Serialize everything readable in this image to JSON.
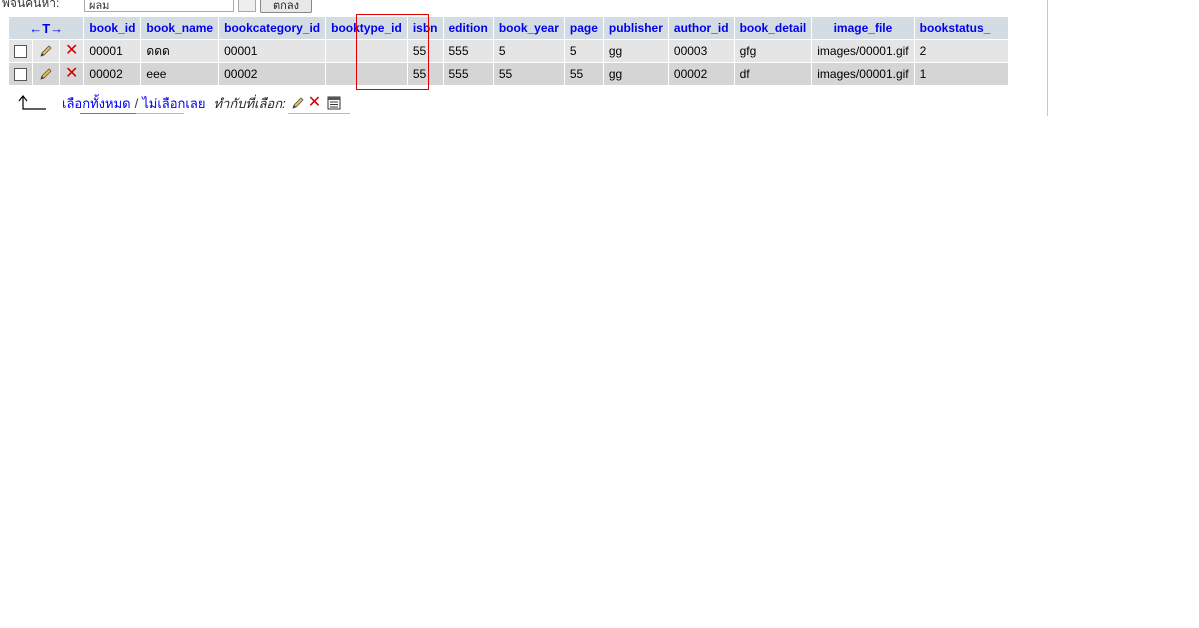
{
  "search": {
    "label": "พจน์ค้นหา:",
    "value": "ผลม",
    "go_label": "ตกลง"
  },
  "table": {
    "arrows_header": "←T→",
    "columns": [
      "book_id",
      "book_name",
      "bookcategory_id",
      "booktype_id",
      "isbn",
      "edition",
      "book_year",
      "page",
      "publisher",
      "author_id",
      "book_detail",
      "image_file",
      "bookstatus_"
    ],
    "rows": [
      {
        "book_id": "00001",
        "book_name": "ดดด",
        "bookcategory_id": "00001",
        "booktype_id": "",
        "isbn": "55",
        "edition": "555",
        "book_year": "5",
        "page": "5",
        "publisher": "gg",
        "author_id": "00003",
        "book_detail": "gfg",
        "image_file": "images/00001.gif",
        "bookstatus_": "2"
      },
      {
        "book_id": "00002",
        "book_name": "eee",
        "bookcategory_id": "00002",
        "booktype_id": "",
        "isbn": "55",
        "edition": "555",
        "book_year": "55",
        "page": "55",
        "publisher": "gg",
        "author_id": "00002",
        "book_detail": "df",
        "image_file": "images/00001.gif",
        "bookstatus_": "1"
      }
    ]
  },
  "footer": {
    "select_all": "เลือกทั้งหมด",
    "separator": "/",
    "deselect_all": "ไม่เลือกเลย",
    "with_selected": "ทำกับที่เลือก:"
  },
  "icons": {
    "edit": "pencil-icon",
    "delete": "delete-x-icon",
    "export": "export-table-icon",
    "arrow": "arrow-up-left-icon"
  },
  "colors": {
    "header_bg": "#d3dce3",
    "header_text": "#0000ee",
    "row_odd": "#e5e5e5",
    "row_even": "#d5d5d5",
    "highlight": "#e00000",
    "delete": "#cc0000"
  }
}
